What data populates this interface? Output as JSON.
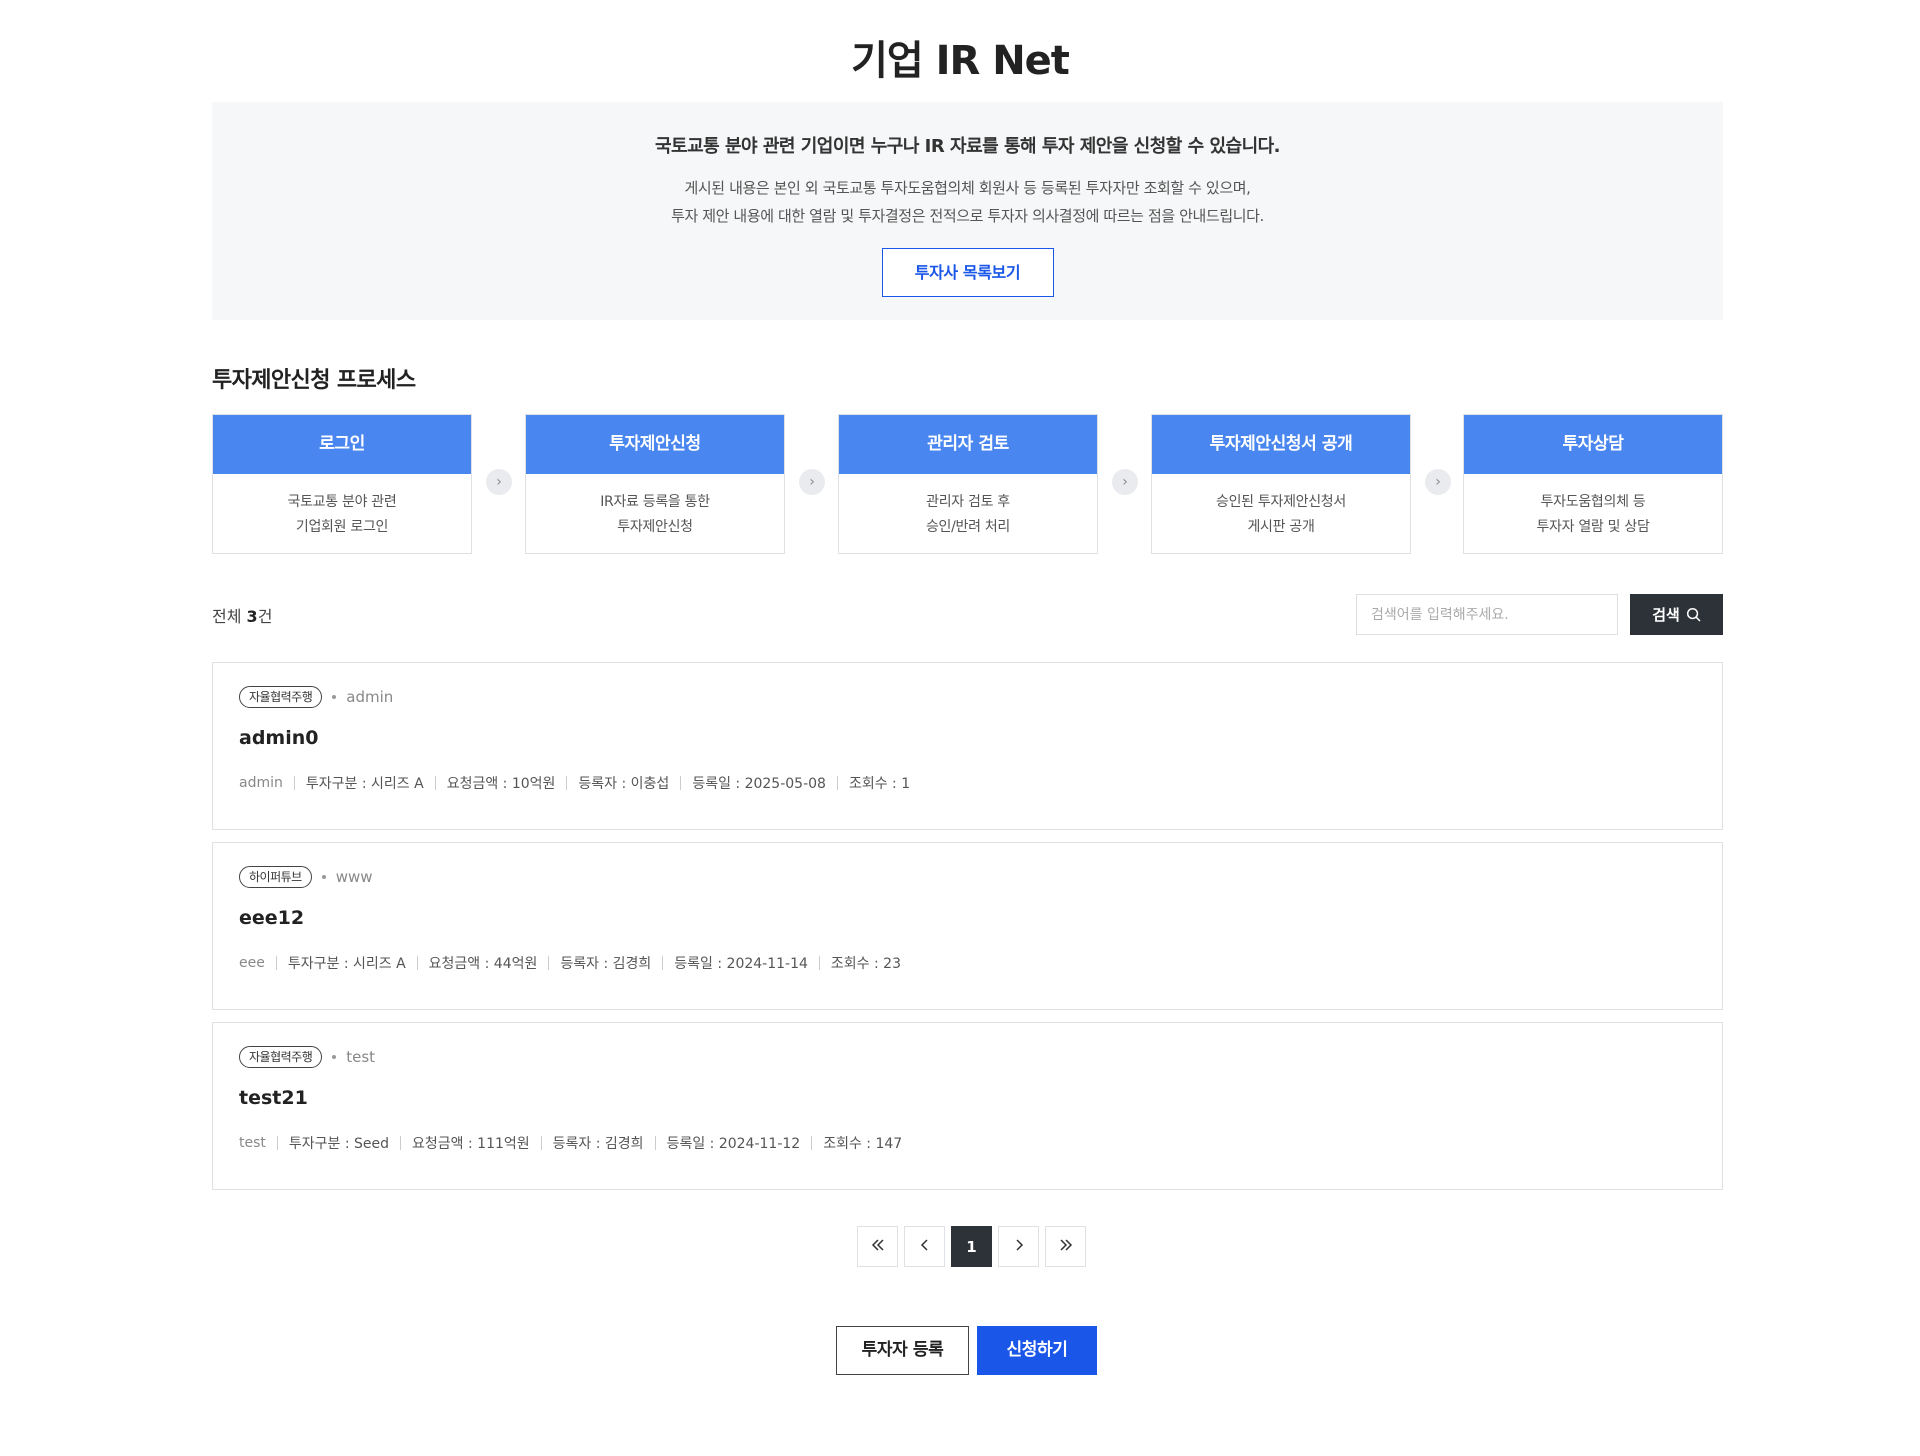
{
  "page_title": "기업 IR Net",
  "notice": {
    "headline": "국토교통 분야 관련 기업이면 누구나 IR 자료를 통해 투자 제안을 신청할 수 있습니다.",
    "line1": "게시된 내용은 본인 외 국토교통 투자도움협의체 회원사 등 등록된 투자자만 조회할 수 있으며,",
    "line2": "투자 제안 내용에 대한 열람 및 투자결정은 전적으로 투자자 의사결정에 따르는 점을 안내드립니다.",
    "button_label": "투자사 목록보기"
  },
  "process": {
    "title": "투자제안신청 프로세스",
    "steps": [
      {
        "title": "로그인",
        "desc": "국토교통 분야 관련\n기업회원 로그인"
      },
      {
        "title": "투자제안신청",
        "desc": "IR자료 등록을 통한\n투자제안신청"
      },
      {
        "title": "관리자 검토",
        "desc": "관리자 검토 후\n승인/반려 처리"
      },
      {
        "title": "투자제안신청서 공개",
        "desc": "승인된 투자제안신청서\n게시판 공개"
      },
      {
        "title": "투자상담",
        "desc": "투자도움협의체 등\n투자자 열람 및 상담"
      }
    ]
  },
  "list": {
    "total_prefix": "전체",
    "total_count": "3",
    "total_suffix": "건",
    "search_placeholder": "검색어를 입력해주세요.",
    "search_button": "검색",
    "icons": {
      "search": "search-icon",
      "arrow": "chevron-right-icon"
    },
    "items": [
      {
        "badge": "자율협력주행",
        "author": "admin",
        "title": "admin0",
        "company": "admin",
        "type": "투자구분 : 시리즈 A",
        "amount": "요청금액 : 10억원",
        "registrant": "등록자 : 이충섭",
        "date": "등록일 : 2025-05-08",
        "views": "조회수 : 1"
      },
      {
        "badge": "하이퍼튜브",
        "author": "www",
        "title": "eee12",
        "company": "eee",
        "type": "투자구분 : 시리즈 A",
        "amount": "요청금액 : 44억원",
        "registrant": "등록자 : 김경희",
        "date": "등록일 : 2024-11-14",
        "views": "조회수 : 23"
      },
      {
        "badge": "자율협력주행",
        "author": "test",
        "title": "test21",
        "company": "test",
        "type": "투자구분 : Seed",
        "amount": "요청금액 : 111억원",
        "registrant": "등록자 : 김경희",
        "date": "등록일 : 2024-11-12",
        "views": "조회수 : 147"
      }
    ]
  },
  "pagination": {
    "first": "«",
    "prev": "‹",
    "current": "1",
    "next": "›",
    "last": "»"
  },
  "actions": {
    "register_investor": "투자자 등록",
    "apply": "신청하기"
  },
  "colors": {
    "primary": "#1a56e8",
    "step_header": "#4a86f0",
    "dark": "#2c3238"
  }
}
